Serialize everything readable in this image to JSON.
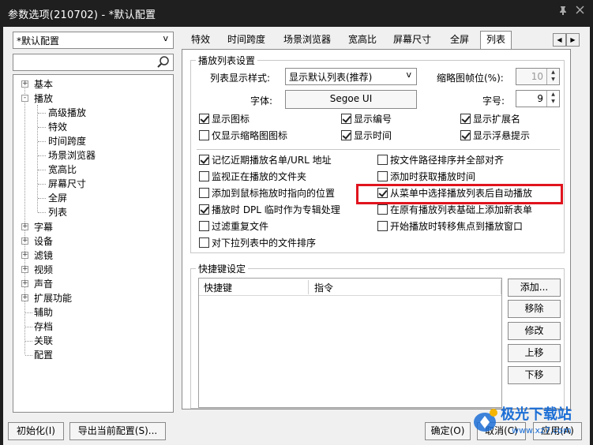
{
  "window": {
    "title": "参数选项(210702) - *默认配置",
    "pin_icon": "pin-icon",
    "close_icon": "close-icon"
  },
  "profile_select": {
    "value": "*默认配置"
  },
  "search": {
    "value": ""
  },
  "tree": {
    "items": [
      {
        "label": "基本",
        "toggle": "+"
      },
      {
        "label": "播放",
        "toggle": "-"
      },
      {
        "label": "高级播放"
      },
      {
        "label": "特效"
      },
      {
        "label": "时间跨度"
      },
      {
        "label": "场景浏览器"
      },
      {
        "label": "宽高比"
      },
      {
        "label": "屏幕尺寸"
      },
      {
        "label": "全屏"
      },
      {
        "label": "列表"
      },
      {
        "label": "字幕",
        "toggle": "+"
      },
      {
        "label": "设备",
        "toggle": "+"
      },
      {
        "label": "滤镜",
        "toggle": "+"
      },
      {
        "label": "视频",
        "toggle": "+"
      },
      {
        "label": "声音",
        "toggle": "+"
      },
      {
        "label": "扩展功能",
        "toggle": "+"
      },
      {
        "label": "辅助"
      },
      {
        "label": "存档"
      },
      {
        "label": "关联"
      },
      {
        "label": "配置"
      }
    ]
  },
  "tabs": [
    "特效",
    "时间跨度",
    "场景浏览器",
    "宽高比",
    "屏幕尺寸",
    "全屏",
    "列表"
  ],
  "tab_scroll": {
    "left": "◀",
    "right": "▶"
  },
  "playlist_settings": {
    "title": "播放列表设置",
    "display_style_label": "列表显示样式:",
    "display_style_value": "显示默认列表(推荐)",
    "thumb_fps_label": "缩略图帧位(%):",
    "thumb_fps_value": "10",
    "font_label": "字体:",
    "font_value": "Segoe UI",
    "size_label": "字号:",
    "size_value": "9",
    "spin_up": "▲",
    "spin_down": "▼",
    "checks_top": [
      {
        "label": "显示图标",
        "checked": true
      },
      {
        "label": "显示编号",
        "checked": true
      },
      {
        "label": "显示扩展名",
        "checked": true
      },
      {
        "label": "仅显示缩略图图标",
        "checked": false
      },
      {
        "label": "显示时间",
        "checked": true
      },
      {
        "label": "显示浮悬提示",
        "checked": true
      }
    ],
    "checks_left": [
      {
        "label": "记忆近期播放名单/URL 地址",
        "checked": true
      },
      {
        "label": "监视正在播放的文件夹",
        "checked": false
      },
      {
        "label": "添加到鼠标拖放时指向的位置",
        "checked": false
      },
      {
        "label": "播放时 DPL 临时作为专辑处理",
        "checked": true
      },
      {
        "label": "过滤重复文件",
        "checked": false
      },
      {
        "label": "对下拉列表中的文件排序",
        "checked": false
      }
    ],
    "checks_right": [
      {
        "label": "按文件路径排序并全部对齐",
        "checked": false
      },
      {
        "label": "添加时获取播放时间",
        "checked": false
      },
      {
        "label": "从菜单中选择播放列表后自动播放",
        "checked": true
      },
      {
        "label": "在原有播放列表基础上添加新表单",
        "checked": false
      },
      {
        "label": "开始播放时转移焦点到播放窗口",
        "checked": false
      }
    ]
  },
  "hotkeys": {
    "title": "快捷键设定",
    "col_hotkey": "快捷键",
    "col_command": "指令",
    "buttons": [
      "添加...",
      "移除",
      "修改",
      "上移",
      "下移"
    ]
  },
  "footer": {
    "init": "初始化(I)",
    "export": "导出当前配置(S)...",
    "ok": "确定(O)",
    "cancel": "取消(C)",
    "apply": "应用(A)"
  },
  "watermark": {
    "text": "极光下载站",
    "url": "www.xz7.com"
  },
  "colors": {
    "highlight": "#e0141e",
    "titlebar": "#1f1f1f",
    "watermark": "#1c6fd6"
  }
}
